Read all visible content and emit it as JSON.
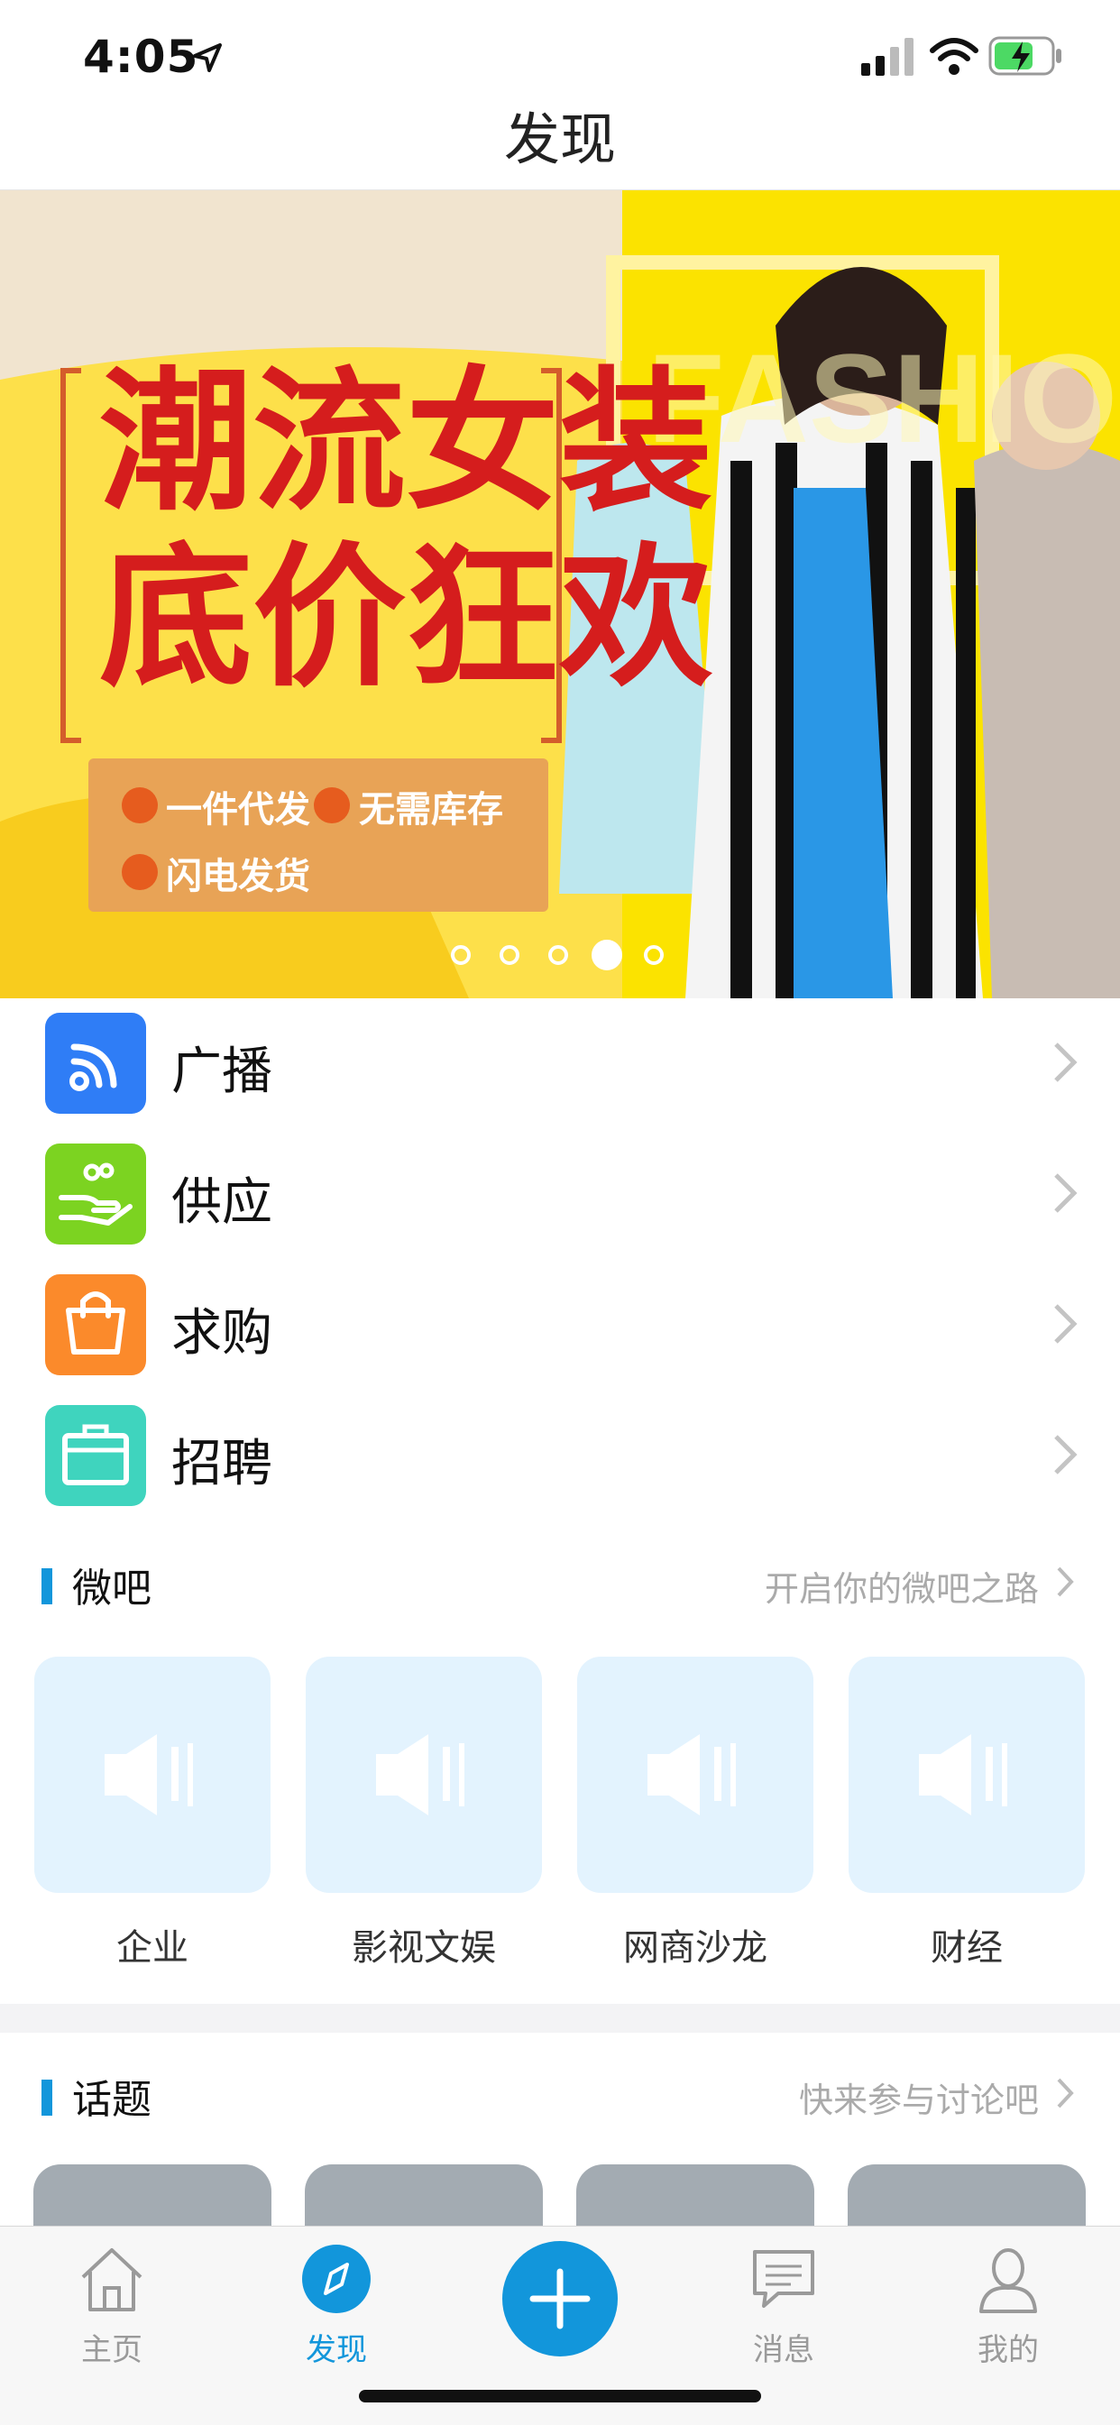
{
  "status": {
    "time": "4:05"
  },
  "nav": {
    "title": "发现"
  },
  "banner": {
    "headline_1": "潮流女装",
    "headline_2": "底价狂欢",
    "feature_1": "一件代发",
    "feature_2": "无需库存",
    "feature_3": "闪电发货",
    "watermark": "FASHION",
    "page_index": 4,
    "page_count": 5
  },
  "menu": {
    "items": [
      {
        "label": "广播",
        "icon": "broadcast-icon",
        "color": "#2f7df6"
      },
      {
        "label": "供应",
        "icon": "supply-hand-icon",
        "color": "#7cd321"
      },
      {
        "label": "求购",
        "icon": "shopping-bag-icon",
        "color": "#fb8a2b"
      },
      {
        "label": "招聘",
        "icon": "briefcase-icon",
        "color": "#3fd4be"
      }
    ]
  },
  "weiba": {
    "title": "微吧",
    "link": "开启你的微吧之路",
    "items": [
      {
        "label": "企业",
        "icon": "speaker-icon"
      },
      {
        "label": "影视文娱",
        "icon": "speaker-icon"
      },
      {
        "label": "网商沙龙",
        "icon": "speaker-icon"
      },
      {
        "label": "财经",
        "icon": "speaker-icon"
      }
    ]
  },
  "topics": {
    "title": "话题",
    "link": "快来参与讨论吧"
  },
  "tabbar": {
    "items": [
      {
        "label": "主页",
        "icon": "home-icon",
        "active": false
      },
      {
        "label": "发现",
        "icon": "compass-icon",
        "active": true
      },
      {
        "label": "",
        "icon": "plus-icon",
        "active": false
      },
      {
        "label": "消息",
        "icon": "message-icon",
        "active": false
      },
      {
        "label": "我的",
        "icon": "person-icon",
        "active": false
      }
    ]
  },
  "colors": {
    "accent": "#1296db",
    "tab_inactive": "#9a9a9a"
  }
}
